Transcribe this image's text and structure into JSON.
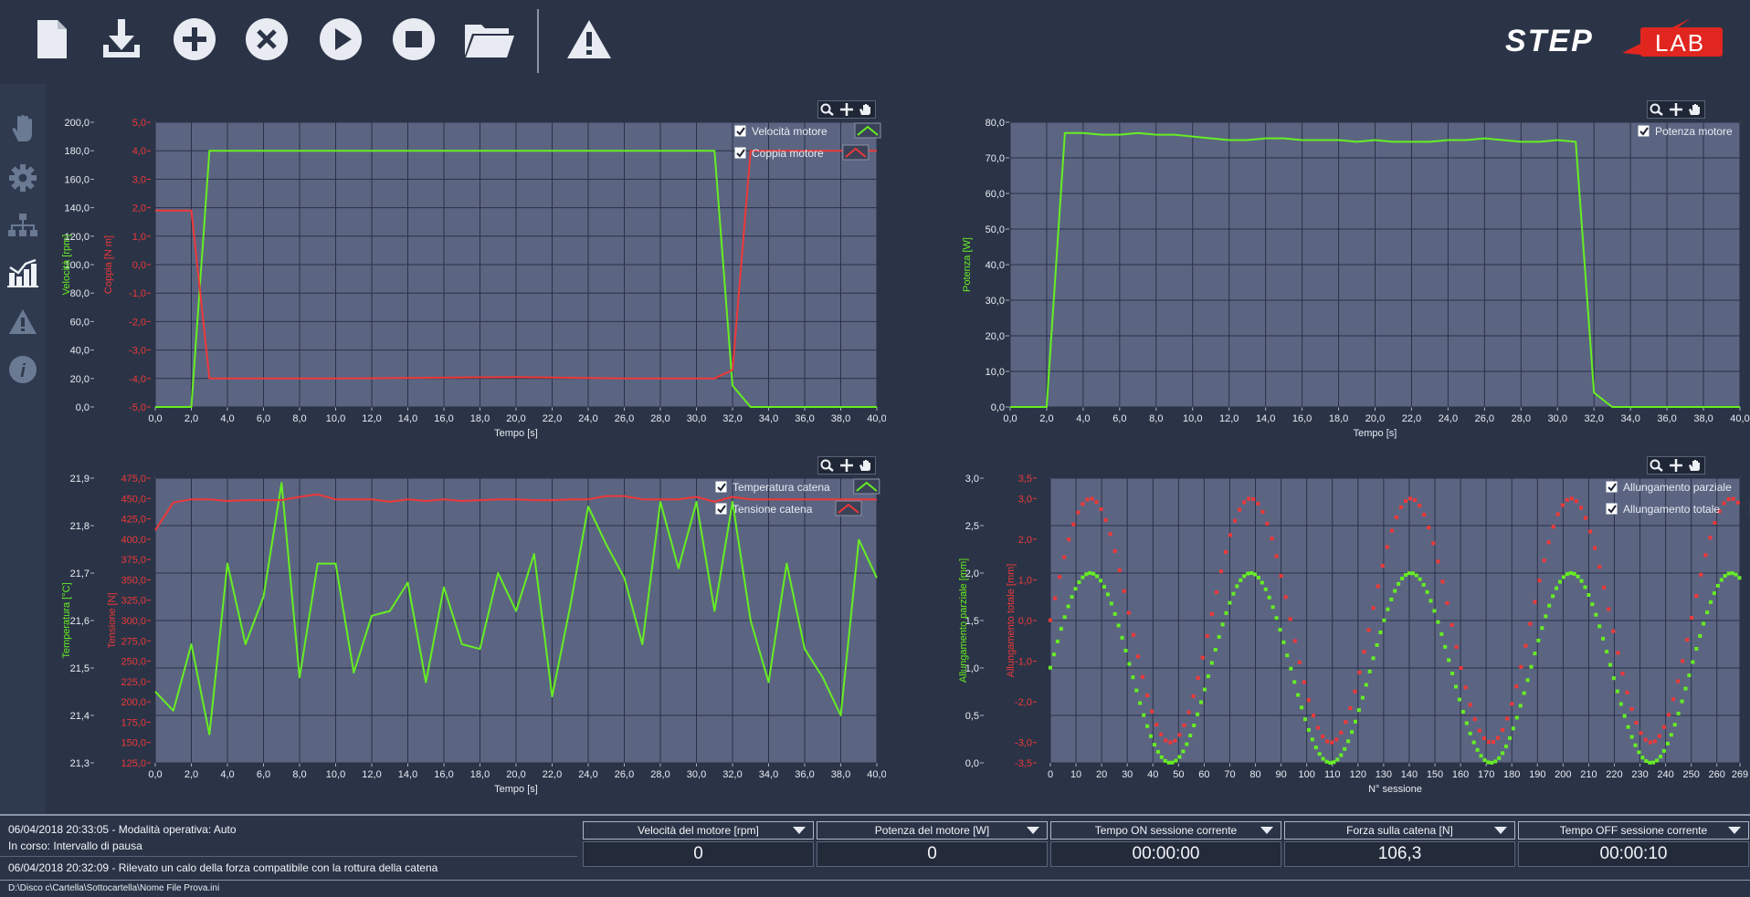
{
  "toolbar": {
    "buttons": [
      "new-file-icon",
      "download-icon",
      "add-icon",
      "cancel-icon",
      "play-icon",
      "stop-icon",
      "folder-icon",
      "warning-icon"
    ]
  },
  "logo": {
    "text_left": "STEP",
    "text_right": "LAB"
  },
  "sidebar": {
    "items": [
      "hand-icon",
      "gear-icon",
      "hierarchy-icon",
      "chart-icon",
      "warning-icon",
      "info-icon"
    ],
    "active": "chart-icon"
  },
  "colors": {
    "green": "#66ee22",
    "red": "#ee3838",
    "plot_bg": "#5b6582",
    "page_bg": "#2b3447"
  },
  "chart_data": [
    {
      "id": "motor",
      "type": "line",
      "xlabel": "Tempo [s]",
      "x_ticks": [
        "0,0",
        "2,0",
        "4,0",
        "6,0",
        "8,0",
        "10,0",
        "12,0",
        "14,0",
        "16,0",
        "18,0",
        "20,0",
        "22,0",
        "24,0",
        "26,0",
        "28,0",
        "30,0",
        "32,0",
        "34,0",
        "36,0",
        "38,0",
        "40,0"
      ],
      "xlim": [
        0,
        40
      ],
      "axes": [
        {
          "label": "Velocità [rpm]",
          "color": "#66ee22",
          "lim": [
            0,
            200
          ],
          "ticks": [
            "0,0",
            "20,0",
            "40,0",
            "60,0",
            "80,0",
            "100,0",
            "120,0",
            "140,0",
            "160,0",
            "180,0",
            "200,0"
          ]
        },
        {
          "label": "Coppia [N m]",
          "color": "#ee3838",
          "lim": [
            -5,
            5
          ],
          "ticks": [
            "-5,0",
            "-4,0",
            "-3,0",
            "-2,0",
            "-1,0",
            "0,0",
            "1,0",
            "2,0",
            "3,0",
            "4,0",
            "5,0"
          ]
        }
      ],
      "series": [
        {
          "name": "Velocità motore",
          "color": "#66ee22",
          "axis": 0,
          "x": [
            0,
            2,
            3,
            12,
            13,
            31,
            32,
            33,
            40
          ],
          "y": [
            0,
            0,
            180,
            180,
            180,
            180,
            15,
            0,
            0
          ]
        },
        {
          "name": "Coppia motore",
          "color": "#ee3838",
          "axis": 1,
          "x": [
            0,
            2,
            3,
            10,
            20,
            26,
            31,
            32,
            33,
            40
          ],
          "y": [
            1.9,
            1.9,
            -4,
            -4,
            -3.95,
            -4,
            -4,
            -3.7,
            4,
            4
          ]
        }
      ]
    },
    {
      "id": "power",
      "type": "line",
      "xlabel": "Tempo [s]",
      "x_ticks": [
        "0,0",
        "2,0",
        "4,0",
        "6,0",
        "8,0",
        "10,0",
        "12,0",
        "14,0",
        "16,0",
        "18,0",
        "20,0",
        "22,0",
        "24,0",
        "26,0",
        "28,0",
        "30,0",
        "32,0",
        "34,0",
        "36,0",
        "38,0",
        "40,0"
      ],
      "xlim": [
        0,
        40
      ],
      "axes": [
        {
          "label": "Potenza [W]",
          "color": "#66ee22",
          "lim": [
            0,
            80
          ],
          "ticks": [
            "0,0",
            "10,0",
            "20,0",
            "30,0",
            "40,0",
            "50,0",
            "60,0",
            "70,0",
            "80,0"
          ]
        }
      ],
      "series": [
        {
          "name": "Potenza motore",
          "color": "#66ee22",
          "axis": 0,
          "x": [
            0,
            2,
            3,
            4,
            5,
            6,
            7,
            8,
            9,
            10,
            11,
            12,
            13,
            14,
            15,
            16,
            17,
            18,
            19,
            20,
            21,
            22,
            23,
            24,
            25,
            26,
            27,
            28,
            29,
            30,
            31,
            32,
            33,
            34,
            40
          ],
          "y": [
            0,
            0,
            77,
            77,
            76.5,
            76.5,
            77,
            76.5,
            76.5,
            76,
            75.5,
            75,
            75,
            75.5,
            75.5,
            75,
            75,
            75,
            74.5,
            75,
            74.5,
            74.5,
            74.5,
            75,
            75,
            75.5,
            75,
            74.5,
            74.5,
            75,
            74.5,
            4,
            0,
            0,
            0
          ]
        }
      ]
    },
    {
      "id": "chain",
      "type": "line",
      "xlabel": "Tempo [s]",
      "x_ticks": [
        "0,0",
        "2,0",
        "4,0",
        "6,0",
        "8,0",
        "10,0",
        "12,0",
        "14,0",
        "16,0",
        "18,0",
        "20,0",
        "22,0",
        "24,0",
        "26,0",
        "28,0",
        "30,0",
        "32,0",
        "34,0",
        "36,0",
        "38,0",
        "40,0"
      ],
      "xlim": [
        0,
        40
      ],
      "axes": [
        {
          "label": "Temperatura [°C]",
          "color": "#66ee22",
          "lim": [
            21.3,
            21.9
          ],
          "ticks": [
            "21,3",
            "21,4",
            "21,5",
            "21,6",
            "21,7",
            "21,8",
            "21,9"
          ]
        },
        {
          "label": "Tensione [N]",
          "color": "#ee3838",
          "lim": [
            125,
            475
          ],
          "ticks": [
            "125,0",
            "150,0",
            "175,0",
            "200,0",
            "225,0",
            "250,0",
            "275,0",
            "300,0",
            "325,0",
            "350,0",
            "375,0",
            "400,0",
            "425,0",
            "450,0",
            "475,0"
          ]
        }
      ],
      "series": [
        {
          "name": "Temperatura catena",
          "color": "#66ee22",
          "axis": 0,
          "x": [
            0,
            1,
            2,
            3,
            4,
            5,
            6,
            7,
            8,
            9,
            10,
            11,
            12,
            13,
            14,
            15,
            16,
            17,
            18,
            19,
            20,
            21,
            22,
            23,
            24,
            25,
            26,
            27,
            28,
            29,
            30,
            31,
            32,
            33,
            34,
            35,
            36,
            37,
            38,
            39,
            40
          ],
          "y": [
            21.45,
            21.41,
            21.55,
            21.36,
            21.72,
            21.55,
            21.65,
            21.89,
            21.48,
            21.72,
            21.72,
            21.49,
            21.61,
            21.62,
            21.68,
            21.47,
            21.67,
            21.55,
            21.54,
            21.7,
            21.62,
            21.74,
            21.44,
            21.63,
            21.84,
            21.76,
            21.69,
            21.55,
            21.85,
            21.71,
            21.85,
            21.62,
            21.85,
            21.6,
            21.47,
            21.72,
            21.54,
            21.48,
            21.4,
            21.77,
            21.69
          ]
        },
        {
          "name": "Tensione catena",
          "color": "#ee3838",
          "axis": 1,
          "x": [
            0,
            1,
            2,
            3,
            4,
            5,
            6,
            7,
            8,
            9,
            10,
            11,
            12,
            13,
            14,
            15,
            16,
            17,
            18,
            19,
            20,
            21,
            22,
            23,
            24,
            25,
            26,
            27,
            28,
            29,
            30,
            31,
            32,
            33,
            34,
            35,
            36,
            37,
            38,
            39,
            40
          ],
          "y": [
            411,
            445,
            449,
            449,
            447,
            448,
            448,
            448,
            452,
            455,
            449,
            449,
            449,
            446,
            449,
            447,
            449,
            447,
            448,
            449,
            449,
            448,
            448,
            449,
            449,
            453,
            453,
            449,
            449,
            449,
            452,
            446,
            452,
            449,
            449,
            449,
            449,
            449,
            449,
            449,
            449
          ]
        }
      ]
    },
    {
      "id": "elongation",
      "type": "scatter",
      "xlabel": "N° sessione",
      "x_ticks": [
        "0",
        "10",
        "20",
        "30",
        "40",
        "50",
        "60",
        "70",
        "80",
        "90",
        "100",
        "110",
        "120",
        "130",
        "140",
        "150",
        "160",
        "170",
        "180",
        "190",
        "200",
        "210",
        "220",
        "230",
        "240",
        "250",
        "260",
        "269"
      ],
      "xlim": [
        0,
        269
      ],
      "axes": [
        {
          "label": "Allungamento parziale [mm]",
          "color": "#66ee22",
          "lim": [
            0,
            3
          ],
          "ticks": [
            "0,0",
            "0,5",
            "1,0",
            "1,5",
            "2,0",
            "2,5",
            "3,0"
          ]
        },
        {
          "label": "Allungamento totale [mm]",
          "color": "#ee3838",
          "lim": [
            -3.5,
            3.5
          ],
          "ticks": [
            "-3,5",
            "-3,0",
            "-2,0",
            "-1,0",
            "0,0",
            "1,0",
            "2,0",
            "3,0",
            "3,5"
          ]
        }
      ],
      "series": [
        {
          "name": "Allungamento parziale",
          "color": "#66ee22",
          "axis": 0,
          "model": {
            "kind": "sine",
            "period": 62.5,
            "phase_x": 15.6,
            "center": 1.0,
            "amplitude": 1.0,
            "step": 1.4
          }
        },
        {
          "name": "Allungamento totale",
          "color": "#ee3838",
          "axis": 1,
          "model": {
            "kind": "sine",
            "period": 62.5,
            "phase_x": 15.6,
            "center": 0.0,
            "amplitude": 3.0,
            "step": 1.8
          }
        }
      ]
    }
  ],
  "status": {
    "log": [
      "06/04/2018 20:33:05 - Modalità operativa: Auto",
      "In corso: Intervallo di pausa",
      "06/04/2018 20:32:09 - Rilevato un calo della forza compatibile con la rottura della catena"
    ],
    "indicators": [
      {
        "label": "Velocità del motore [rpm]",
        "value": "0"
      },
      {
        "label": "Potenza del motore [W]",
        "value": "0"
      },
      {
        "label": "Tempo ON sessione corrente",
        "value": "00:00:00"
      },
      {
        "label": "Forza sulla catena [N]",
        "value": "106,3"
      },
      {
        "label": "Tempo OFF sessione corrente",
        "value": "00:00:10"
      }
    ],
    "path": "D:\\Disco c\\Cartella\\Sottocartella\\Nome File Prova.ini"
  }
}
